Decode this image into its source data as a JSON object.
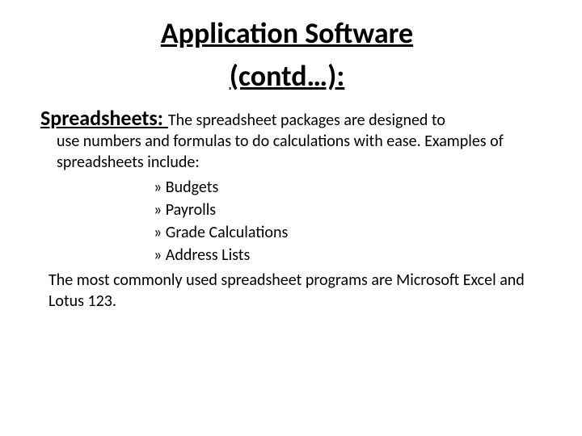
{
  "title": "Application Software",
  "subtitle": " (contd…):",
  "section": {
    "heading": "Spreadsheets: ",
    "lead": " The spreadsheet packages are designed to",
    "body": "use numbers and formulas to do calculations with ease. Examples of spreadsheets include:",
    "items": [
      "Budgets",
      "Payrolls",
      "Grade Calculations",
      "Address Lists"
    ],
    "trailer": "The most commonly used spreadsheet programs are Microsoft Excel and Lotus 123."
  }
}
